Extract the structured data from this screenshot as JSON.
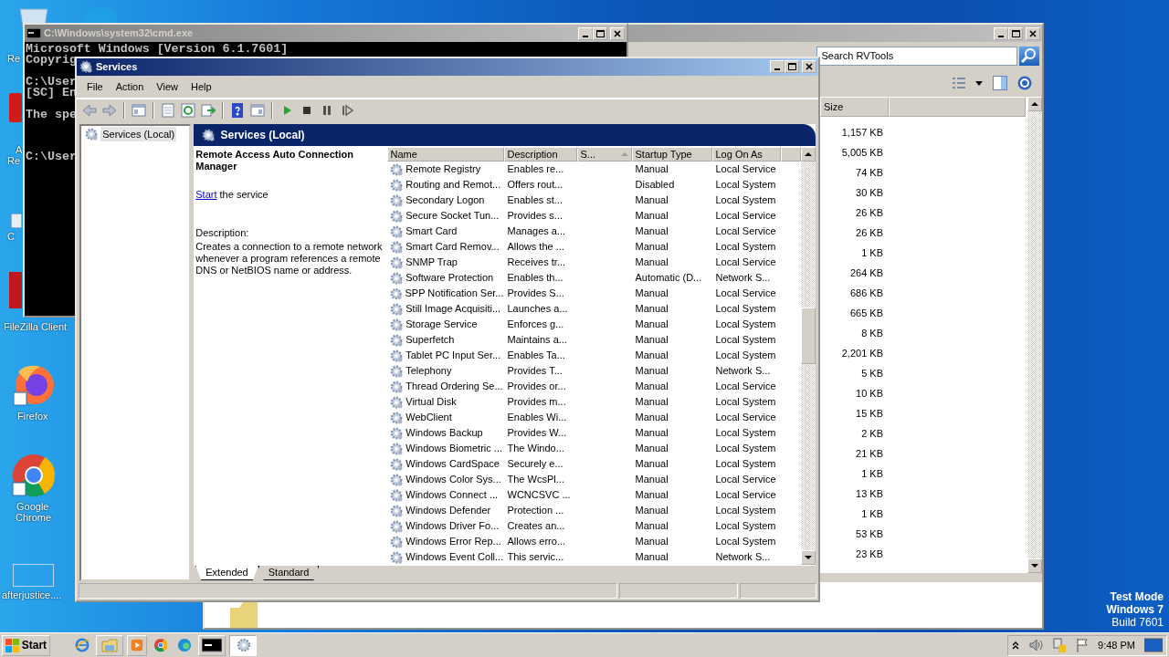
{
  "desktop_icons": [
    {
      "kind": "recycle",
      "label_lines": [
        "Re"
      ]
    },
    {
      "kind": "reader",
      "label_lines": [
        "A",
        "Re"
      ]
    },
    {
      "kind": "app",
      "label_lines": [
        "C"
      ]
    },
    {
      "kind": "filezilla",
      "label_lines": [
        "FileZilla Client"
      ]
    },
    {
      "kind": "firefox",
      "label_lines": [
        "Firefox"
      ]
    },
    {
      "kind": "chrome",
      "label_lines": [
        "Google",
        "Chrome"
      ]
    },
    {
      "kind": "file",
      "label_lines": [
        "afterjustice...."
      ]
    }
  ],
  "cmd_window": {
    "title": "C:\\Windows\\system32\\cmd.exe",
    "paragraphs": [
      [
        "Microsoft Windows [Version 6.1.7601]",
        "Copyrig"
      ],
      [
        "C:\\User",
        "[SC] En"
      ],
      [
        "The spe"
      ],
      [
        "C:\\User"
      ]
    ]
  },
  "explorer_window": {
    "search": {
      "placeholder": "Search RVTools"
    },
    "columns": [
      "Size"
    ],
    "sizes": [
      "1,157 KB",
      "5,005 KB",
      "74 KB",
      "30 KB",
      "26 KB",
      "26 KB",
      "1 KB",
      "264 KB",
      "686 KB",
      "665 KB",
      "8 KB",
      "2,201 KB",
      "5 KB",
      "10 KB",
      "15 KB",
      "2 KB",
      "21 KB",
      "1 KB",
      "13 KB",
      "1 KB",
      "53 KB",
      "23 KB"
    ]
  },
  "services_window": {
    "title": "Services",
    "menu": [
      "File",
      "Action",
      "View",
      "Help"
    ],
    "tree": [
      {
        "label": "Services (Local)",
        "selected": true
      }
    ],
    "header": "Services (Local)",
    "detail": {
      "title": "Remote Access Auto Connection Manager",
      "link": "Start",
      "link_rest": " the service",
      "description_label": "Description:",
      "description": "Creates a connection to a remote network whenever a program references a remote DNS or NetBIOS name or address."
    },
    "columns": [
      {
        "label": "Name",
        "sorted": false
      },
      {
        "label": "Description",
        "sorted": false
      },
      {
        "label": "S...",
        "sorted": true
      },
      {
        "label": "Startup Type",
        "sorted": false
      },
      {
        "label": "Log On As",
        "sorted": false
      }
    ],
    "rows": [
      [
        "Remote Registry",
        "Enables re...",
        "",
        "Manual",
        "Local Service"
      ],
      [
        "Routing and Remot...",
        "Offers rout...",
        "",
        "Disabled",
        "Local System"
      ],
      [
        "Secondary Logon",
        "Enables st...",
        "",
        "Manual",
        "Local System"
      ],
      [
        "Secure Socket Tun...",
        "Provides s...",
        "",
        "Manual",
        "Local Service"
      ],
      [
        "Smart Card",
        "Manages a...",
        "",
        "Manual",
        "Local Service"
      ],
      [
        "Smart Card Remov...",
        "Allows the ...",
        "",
        "Manual",
        "Local System"
      ],
      [
        "SNMP Trap",
        "Receives tr...",
        "",
        "Manual",
        "Local Service"
      ],
      [
        "Software Protection",
        "Enables th...",
        "",
        "Automatic (D...",
        "Network S..."
      ],
      [
        "SPP Notification Ser...",
        "Provides S...",
        "",
        "Manual",
        "Local Service"
      ],
      [
        "Still Image Acquisiti...",
        "Launches a...",
        "",
        "Manual",
        "Local System"
      ],
      [
        "Storage Service",
        "Enforces g...",
        "",
        "Manual",
        "Local System"
      ],
      [
        "Superfetch",
        "Maintains a...",
        "",
        "Manual",
        "Local System"
      ],
      [
        "Tablet PC Input Ser...",
        "Enables Ta...",
        "",
        "Manual",
        "Local System"
      ],
      [
        "Telephony",
        "Provides T...",
        "",
        "Manual",
        "Network S..."
      ],
      [
        "Thread Ordering Se...",
        "Provides or...",
        "",
        "Manual",
        "Local Service"
      ],
      [
        "Virtual Disk",
        "Provides m...",
        "",
        "Manual",
        "Local System"
      ],
      [
        "WebClient",
        "Enables Wi...",
        "",
        "Manual",
        "Local Service"
      ],
      [
        "Windows Backup",
        "Provides W...",
        "",
        "Manual",
        "Local System"
      ],
      [
        "Windows Biometric ...",
        "The Windo...",
        "",
        "Manual",
        "Local System"
      ],
      [
        "Windows CardSpace",
        "Securely e...",
        "",
        "Manual",
        "Local System"
      ],
      [
        "Windows Color Sys...",
        "The WcsPl...",
        "",
        "Manual",
        "Local Service"
      ],
      [
        "Windows Connect ...",
        "WCNCSVC ...",
        "",
        "Manual",
        "Local Service"
      ],
      [
        "Windows Defender",
        "Protection ...",
        "",
        "Manual",
        "Local System"
      ],
      [
        "Windows Driver Fo...",
        "Creates an...",
        "",
        "Manual",
        "Local System"
      ],
      [
        "Windows Error Rep...",
        "Allows erro...",
        "",
        "Manual",
        "Local System"
      ],
      [
        "Windows Event Coll...",
        "This servic...",
        "",
        "Manual",
        "Network S..."
      ]
    ],
    "tabs": [
      {
        "label": "Extended",
        "selected": true
      },
      {
        "label": "Standard",
        "selected": false
      }
    ]
  },
  "taskbar": {
    "start": "Start",
    "quick_launch": [
      {
        "kind": "ie"
      },
      {
        "kind": "folder"
      },
      {
        "kind": "media"
      },
      {
        "kind": "chrome"
      },
      {
        "kind": "edge"
      }
    ],
    "windows": [
      {
        "kind": "cmd",
        "selected": false
      },
      {
        "kind": "services",
        "selected": true
      }
    ],
    "clock": "9:48 PM"
  },
  "os_notice": [
    "Test Mode",
    "Windows 7",
    "Build 7601"
  ]
}
